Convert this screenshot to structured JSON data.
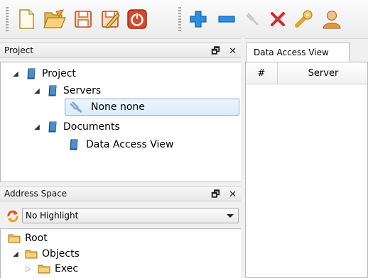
{
  "toolbar": {
    "buttons": [
      {
        "icon": "new-file-icon"
      },
      {
        "icon": "open-folder-icon"
      },
      {
        "icon": "save-icon"
      },
      {
        "icon": "edit-icon"
      },
      {
        "icon": "power-icon"
      },
      {
        "icon": "add-icon"
      },
      {
        "icon": "remove-icon"
      },
      {
        "icon": "disconnect-icon"
      },
      {
        "icon": "delete-icon"
      },
      {
        "icon": "settings-icon"
      },
      {
        "icon": "user-icon"
      }
    ]
  },
  "project_panel": {
    "title": "Project",
    "float_glyph": "🗗",
    "close_glyph": "✕",
    "tree": [
      {
        "label": "Project",
        "level": 0,
        "expanded": true,
        "icon": "project-icon"
      },
      {
        "label": "Servers",
        "level": 1,
        "expanded": true,
        "icon": "servers-icon"
      },
      {
        "label": "None none",
        "level": 2,
        "expanded": null,
        "icon": "server-disconnected-icon",
        "selected": true
      },
      {
        "label": "Documents",
        "level": 1,
        "expanded": true,
        "icon": "documents-icon"
      },
      {
        "label": "Data Access View",
        "level": 2,
        "expanded": null,
        "icon": "document-icon"
      }
    ]
  },
  "address_panel": {
    "title": "Address Space",
    "float_glyph": "🗗",
    "close_glyph": "✕",
    "highlight_select": "No Highlight",
    "tree": [
      {
        "label": "Root",
        "level": 0,
        "expanded": null,
        "icon": "folder-icon"
      },
      {
        "label": "Objects",
        "level": 1,
        "expanded": true,
        "icon": "folder-icon"
      },
      {
        "label": "Exec",
        "level": 2,
        "expanded": false,
        "icon": "folder-icon"
      }
    ]
  },
  "data_view": {
    "tab_label": "Data Access View",
    "columns": [
      "#",
      "Server"
    ]
  },
  "colors": {
    "accent": "#1b7fd3",
    "folder": "#e8b84a",
    "danger": "#d62a1e"
  }
}
